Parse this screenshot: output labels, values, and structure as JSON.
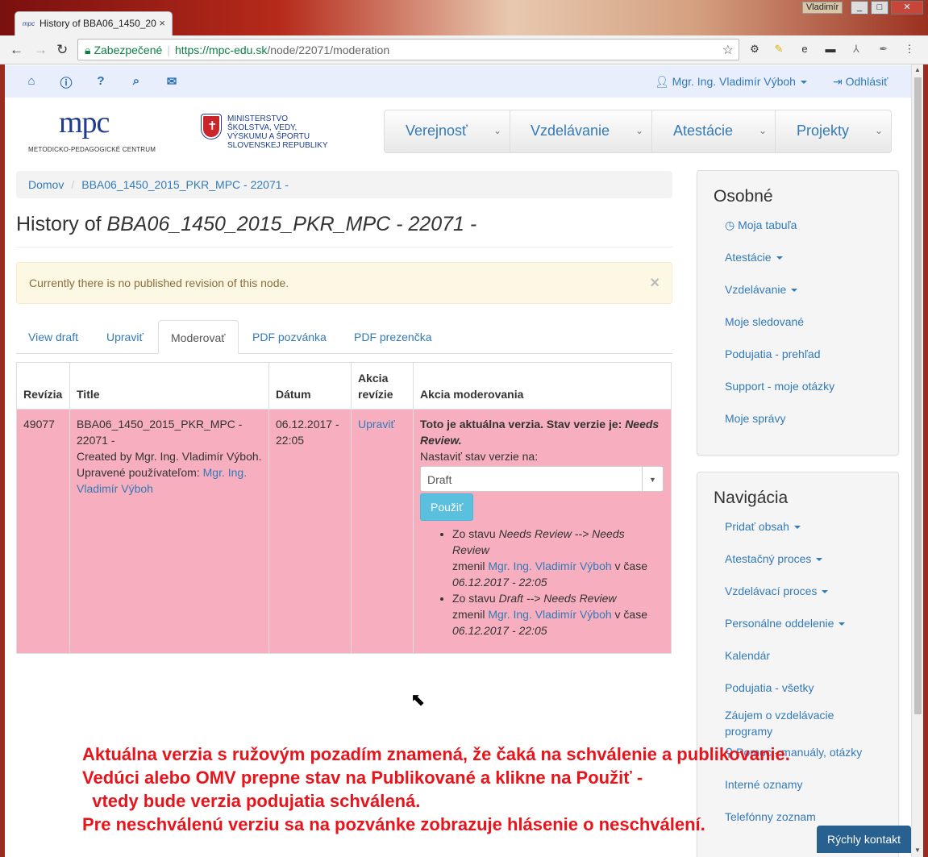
{
  "browser": {
    "tab_title": "History of BBA06_1450_20",
    "tab_favicon": "mpc",
    "window_user": "Vladimír",
    "window_buttons": [
      "_",
      "□",
      "✕"
    ],
    "address": {
      "secure_label": "Zabezpečené",
      "scheme_host": "https://mpc-edu.sk",
      "path": "/node/22071/moderation"
    },
    "extensions": [
      "gear-icon",
      "pen-icon",
      "e-icon",
      "bar-icon",
      "pdf-icon",
      "feather-icon",
      "menu-icon"
    ]
  },
  "userbar": {
    "icons": [
      "home-icon",
      "info-icon",
      "help-icon",
      "search-icon",
      "mail-icon"
    ],
    "user_name": "Mgr. Ing. Vladimír Výboh",
    "logout": "Odhlásiť"
  },
  "header": {
    "logo_text": "mpc",
    "logo_sub": "METODICKO-PEDAGOGICKÉ CENTRUM",
    "ministry_lines": [
      "MINISTERSTVO",
      "ŠKOLSTVA, VEDY,",
      "VÝSKUMU A ŠPORTU",
      "SLOVENSKEJ REPUBLIKY"
    ],
    "nav": [
      "Verejnosť",
      "Vzdelávanie",
      "Atestácie",
      "Projekty"
    ]
  },
  "breadcrumb": {
    "home": "Domov",
    "current": "BBA06_1450_2015_PKR_MPC - 22071 -"
  },
  "page": {
    "title_prefix": "History of ",
    "title_node": "BBA06_1450_2015_PKR_MPC - 22071 -"
  },
  "alert": {
    "text": "Currently there is no published revision of this node.",
    "close": "×"
  },
  "tabs": [
    "View draft",
    "Upraviť",
    "Moderovať",
    "PDF pozvánka",
    "PDF prezenčka"
  ],
  "table": {
    "headers": [
      "Revízia",
      "Title",
      "Dátum",
      "Akcia revízie",
      "Akcia moderovania"
    ],
    "row": {
      "revision": "49077",
      "title": "BBA06_1450_2015_PKR_MPC - 22071 -",
      "created_by": "Created by Mgr. Ing. Vladimír Výboh.",
      "edited_by_label": "Upravené používateľom: ",
      "edited_by_user": "Mgr. Ing. Vladimír Výboh",
      "date": "06.12.2017 - 22:05",
      "action": "Upraviť",
      "moderation": {
        "current_prefix": "Toto je aktuálna verzia. Stav verzie je: ",
        "current_state": "Needs Review.",
        "set_label": "Nastaviť stav verzie na:",
        "select_value": "Draft",
        "apply_button": "Použiť",
        "history": [
          {
            "from_label": "Zo stavu ",
            "transition": "Needs Review --> Needs Review",
            "changed_by": "zmenil ",
            "user": "Mgr. Ing. Vladimír Výboh",
            "at": " v čase",
            "time": "06.12.2017 - 22:05"
          },
          {
            "from_label": "Zo stavu ",
            "transition": "Draft --> Needs Review",
            "changed_by": "zmenil ",
            "user": "Mgr. Ing. Vladimír Výboh",
            "at": " v čase",
            "time": "06.12.2017 - 22:05"
          }
        ]
      }
    }
  },
  "sidebar": {
    "personal": {
      "title": "Osobné",
      "items": [
        "Moja tabuľa",
        "Atestácie",
        "Vzdelávanie",
        "Moje sledované",
        "Podujatia - prehľad",
        "Support - moje otázky",
        "Moje správy"
      ]
    },
    "navigation": {
      "title": "Navigácia",
      "items": [
        "Pridať obsah",
        "Atestačný proces",
        "Vzdelávací proces",
        "Personálne oddelenie",
        "Kalendár",
        "Podujatia - všetky",
        "Záujem o vzdelávacie programy",
        "Pomoc - manuály, otázky",
        "Interné oznamy",
        "Telefónny zoznam"
      ]
    }
  },
  "annotation": [
    "Aktuálna verzia s ružovým pozadím znamená, že čaká na schválenie a publikovanie.",
    "Vedúci alebo OMV prepne stav na Publikované a klikne na Použiť -",
    "  vtedy bude verzia podujatia schválená.",
    "Pre neschválenú verziu sa na pozvánke zobrazuje hlásenie o neschválení."
  ],
  "quick_contact": "Rýchly kontakt",
  "colors": {
    "row_pending": "#f7aebe",
    "link": "#337ab7",
    "annotation": "#e8141b",
    "alert_bg": "#fcf8e3"
  }
}
